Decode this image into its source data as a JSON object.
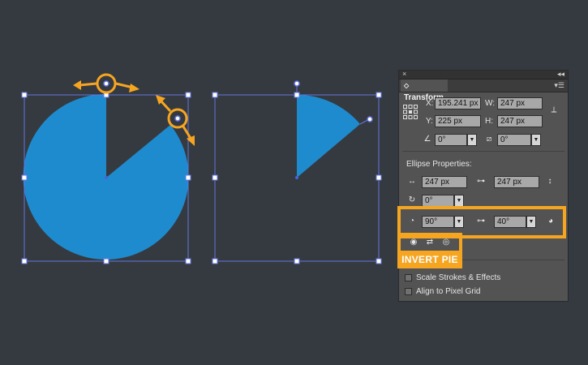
{
  "panel": {
    "close_glyph": "×",
    "collapse_glyph": "◂◂",
    "tab_label": "Transform",
    "menu_glyph": "▾☰",
    "x_label": "X:",
    "x_value": "195.241 px",
    "w_label": "W:",
    "w_value": "247 px",
    "y_label": "Y:",
    "y_value": "225 px",
    "h_label": "H:",
    "h_value": "247 px",
    "rotate_value": "0°",
    "shear_value": "0°",
    "ellipse_section_title": "Ellipse Properties:",
    "ellipse_width_value": "247 px",
    "ellipse_height_value": "247 px",
    "ellipse_rotate_value": "0°",
    "pie_start_value": "90°",
    "pie_end_value": "40°",
    "scale_strokes_label": "Scale Strokes & Effects",
    "align_pixel_grid_label": "Align to Pixel Grid"
  },
  "callout": {
    "invert_pie_label": "INVERT PIE"
  },
  "colors": {
    "background": "#353a40",
    "pie_fill": "#1f8bcf",
    "bounding_box": "#6475e0",
    "highlight_orange": "#f6a521",
    "panel_bg": "#535353"
  },
  "icons": {
    "reference_point": "reference-point-grid-icon",
    "constrain_link": "link-icon",
    "rotate": "rotate-icon",
    "shear": "shear-icon",
    "pie_start": "pie-start-angle-icon",
    "pie_end": "pie-end-angle-icon",
    "invert_pie": "invert-pie-icon",
    "swap": "swap-arrows-icon"
  }
}
